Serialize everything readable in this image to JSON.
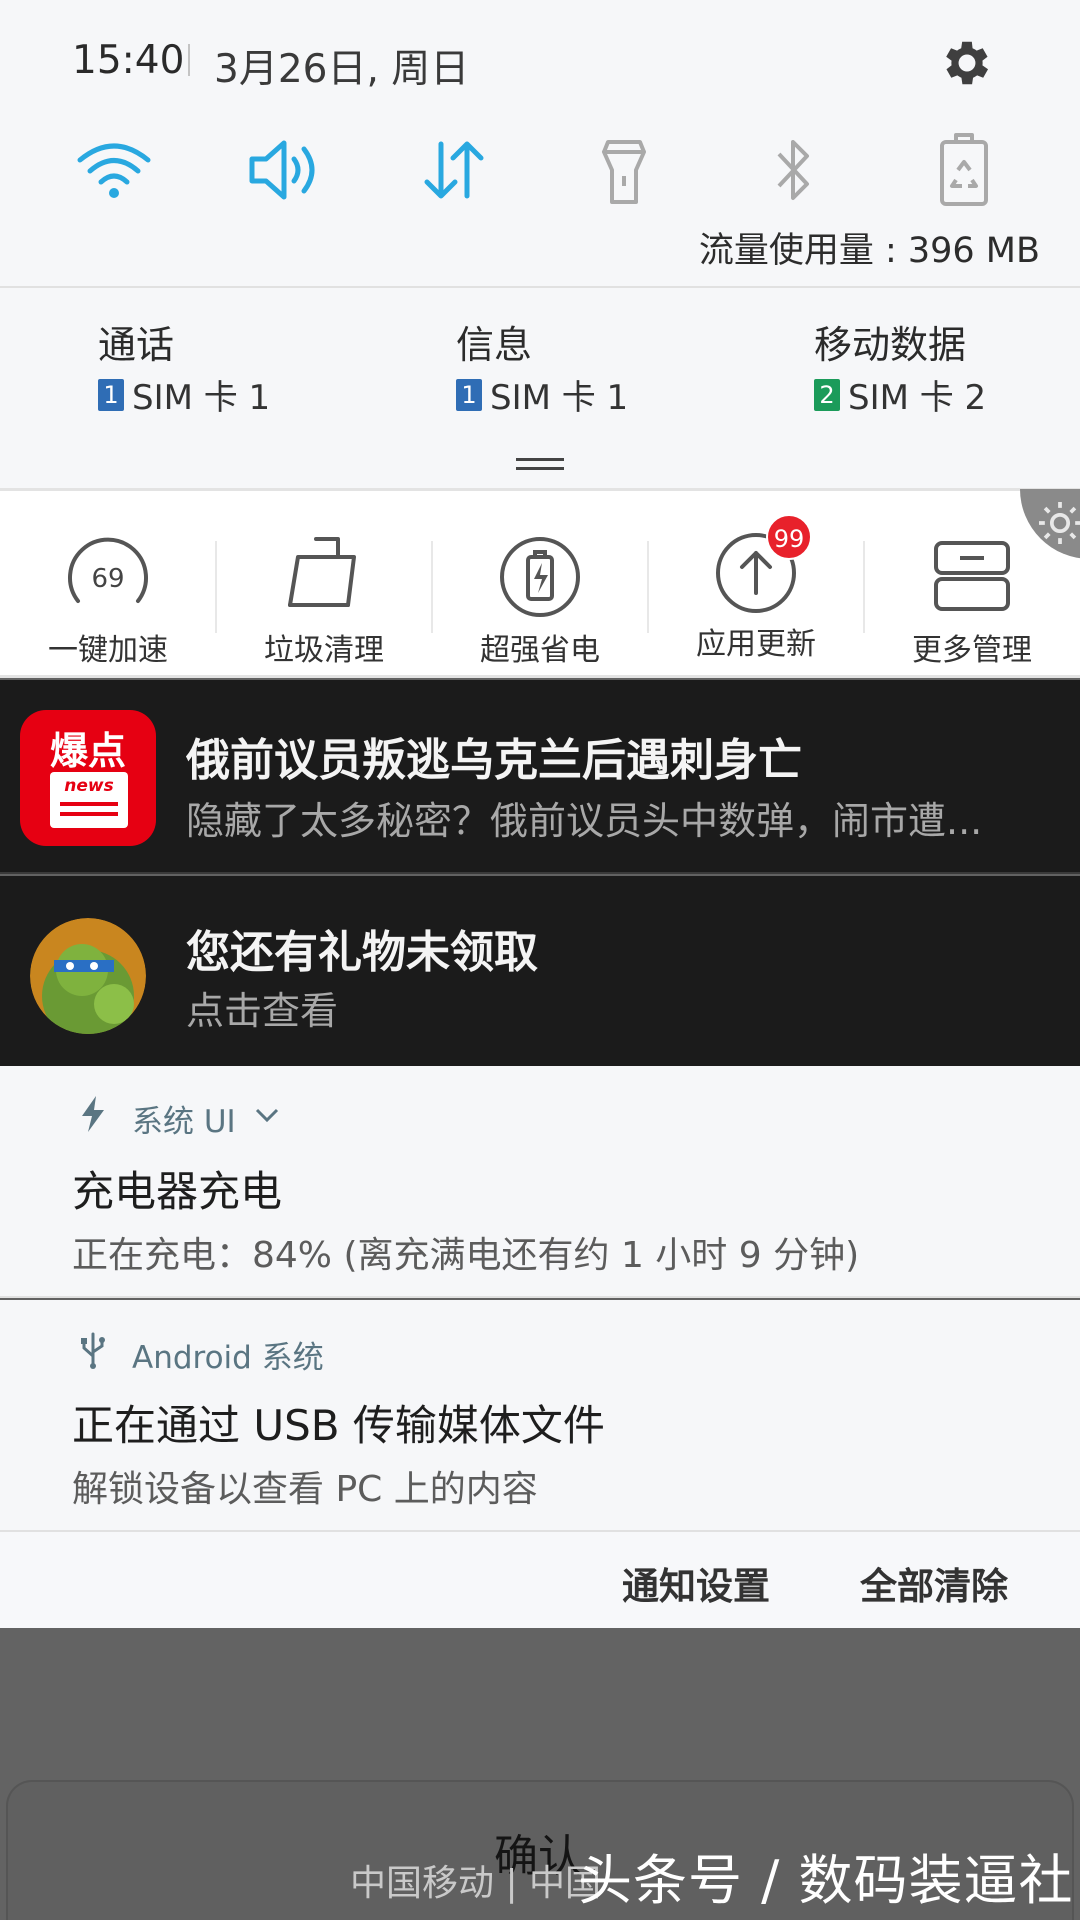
{
  "status": {
    "time": "15:40",
    "date": "3月26日, 周日",
    "data_usage": "流量使用量 : 396 MB"
  },
  "toggles": [
    {
      "name": "wifi-icon",
      "active": true
    },
    {
      "name": "sound-icon",
      "active": true
    },
    {
      "name": "mobile-data-icon",
      "active": true
    },
    {
      "name": "flashlight-icon",
      "active": false
    },
    {
      "name": "bluetooth-icon",
      "active": false
    },
    {
      "name": "power-saving-icon",
      "active": false
    }
  ],
  "sim": [
    {
      "title": "通话",
      "badge": "1",
      "label": "SIM 卡 1",
      "color": "#2f6db5"
    },
    {
      "title": "信息",
      "badge": "1",
      "label": "SIM 卡 1",
      "color": "#2f6db5"
    },
    {
      "title": "移动数据",
      "badge": "2",
      "label": "SIM 卡 2",
      "color": "#1b9b5a"
    }
  ],
  "tools": [
    {
      "label": "一键加速",
      "value": "69"
    },
    {
      "label": "垃圾清理"
    },
    {
      "label": "超强省电"
    },
    {
      "label": "应用更新",
      "badge": "99"
    },
    {
      "label": "更多管理"
    }
  ],
  "notifications": {
    "news": {
      "icon_text": "爆点",
      "icon_subtext": "news",
      "title": "俄前议员叛逃乌克兰后遇刺身亡",
      "body": "隐藏了太多秘密？俄前议员头中数弹，闹市遭..."
    },
    "gift": {
      "title": "您还有礼物未领取",
      "body": "点击查看"
    },
    "charging": {
      "app": "系统 UI",
      "title": "充电器充电",
      "body": "正在充电：84% (离充满电还有约 1 小时 9 分钟)"
    },
    "usb": {
      "app": "Android 系统",
      "title": "正在通过 USB 传输媒体文件",
      "body": "解锁设备以查看 PC 上的内容"
    }
  },
  "actions": {
    "settings": "通知设置",
    "clear": "全部清除"
  },
  "bottom": {
    "confirm": "确认",
    "carrier": "中国移动 | 中国",
    "watermark": "头条号 / 数码装逼社"
  },
  "colors": {
    "accent": "#29a8e0",
    "inactive": "#a9a9a9",
    "dark_bg": "#1b1b1b",
    "light_bg": "#f6f7f9",
    "news_red": "#e60012",
    "badge_red": "#e8212b"
  }
}
